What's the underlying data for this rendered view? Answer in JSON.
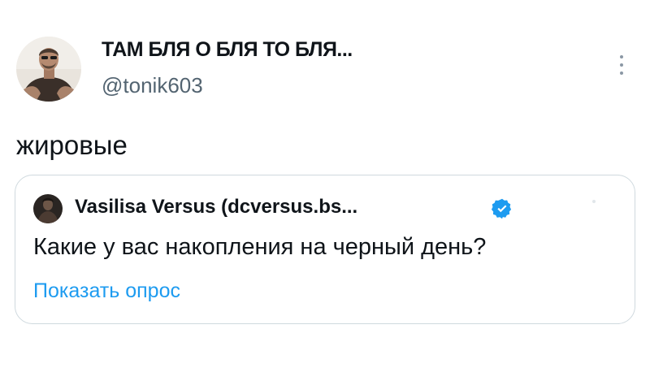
{
  "author": {
    "display_name": "ТАМ БЛЯ О БЛЯ ТО БЛЯ...",
    "handle": "@tonik603",
    "avatar_icon": "user-avatar-photo"
  },
  "tweet": {
    "text": "жировые"
  },
  "quoted_tweet": {
    "author_name": "Vasilisa Versus (dcversus.bs...",
    "verified": true,
    "text": "Какие у вас накопления на черный день?",
    "show_poll_label": "Показать опрос"
  },
  "colors": {
    "accent": "#1d9bf0",
    "secondary_text": "#536471",
    "border": "#cfd9de"
  },
  "icons": {
    "more": "more-vertical-icon",
    "verified": "verified-badge-icon"
  }
}
